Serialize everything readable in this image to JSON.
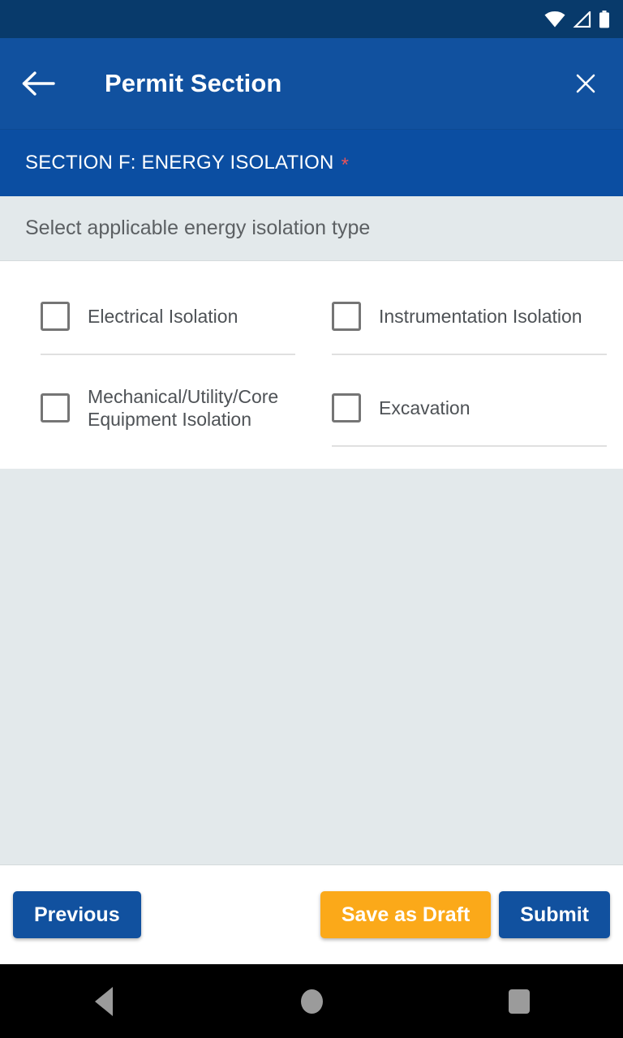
{
  "status_bar": {
    "wifi_icon": "wifi-icon",
    "signal_icon": "cellular-signal-icon",
    "battery_icon": "battery-icon",
    "background_color": "#083a6b"
  },
  "app_bar": {
    "back_icon": "back-arrow-icon",
    "title": "Permit Section",
    "close_icon": "close-icon",
    "background_color": "#11519f"
  },
  "section": {
    "title": "SECTION F: ENERGY ISOLATION",
    "required_marker": "*",
    "required_color": "#e8545a",
    "background_color": "#0b4ea2"
  },
  "prompt": {
    "text": "Select applicable energy isolation type",
    "background_color": "#e3e9eb"
  },
  "options": [
    {
      "label": "Electrical Isolation",
      "checked": false,
      "column": "left",
      "divider": true
    },
    {
      "label": "Instrumentation Isolation",
      "checked": false,
      "column": "right",
      "divider": true
    },
    {
      "label": "Mechanical/Utility/Core Equipment Isolation",
      "checked": false,
      "column": "left",
      "divider": false
    },
    {
      "label": "Excavation",
      "checked": false,
      "column": "right",
      "divider": true
    }
  ],
  "footer": {
    "previous_label": "Previous",
    "save_draft_label": "Save as Draft",
    "submit_label": "Submit",
    "previous_color": "#11519f",
    "save_draft_color": "#fba919",
    "submit_color": "#11519f"
  },
  "nav_bar": {
    "back_icon": "nav-back-icon",
    "home_icon": "nav-home-icon",
    "recents_icon": "nav-recents-icon",
    "background_color": "#000000"
  }
}
